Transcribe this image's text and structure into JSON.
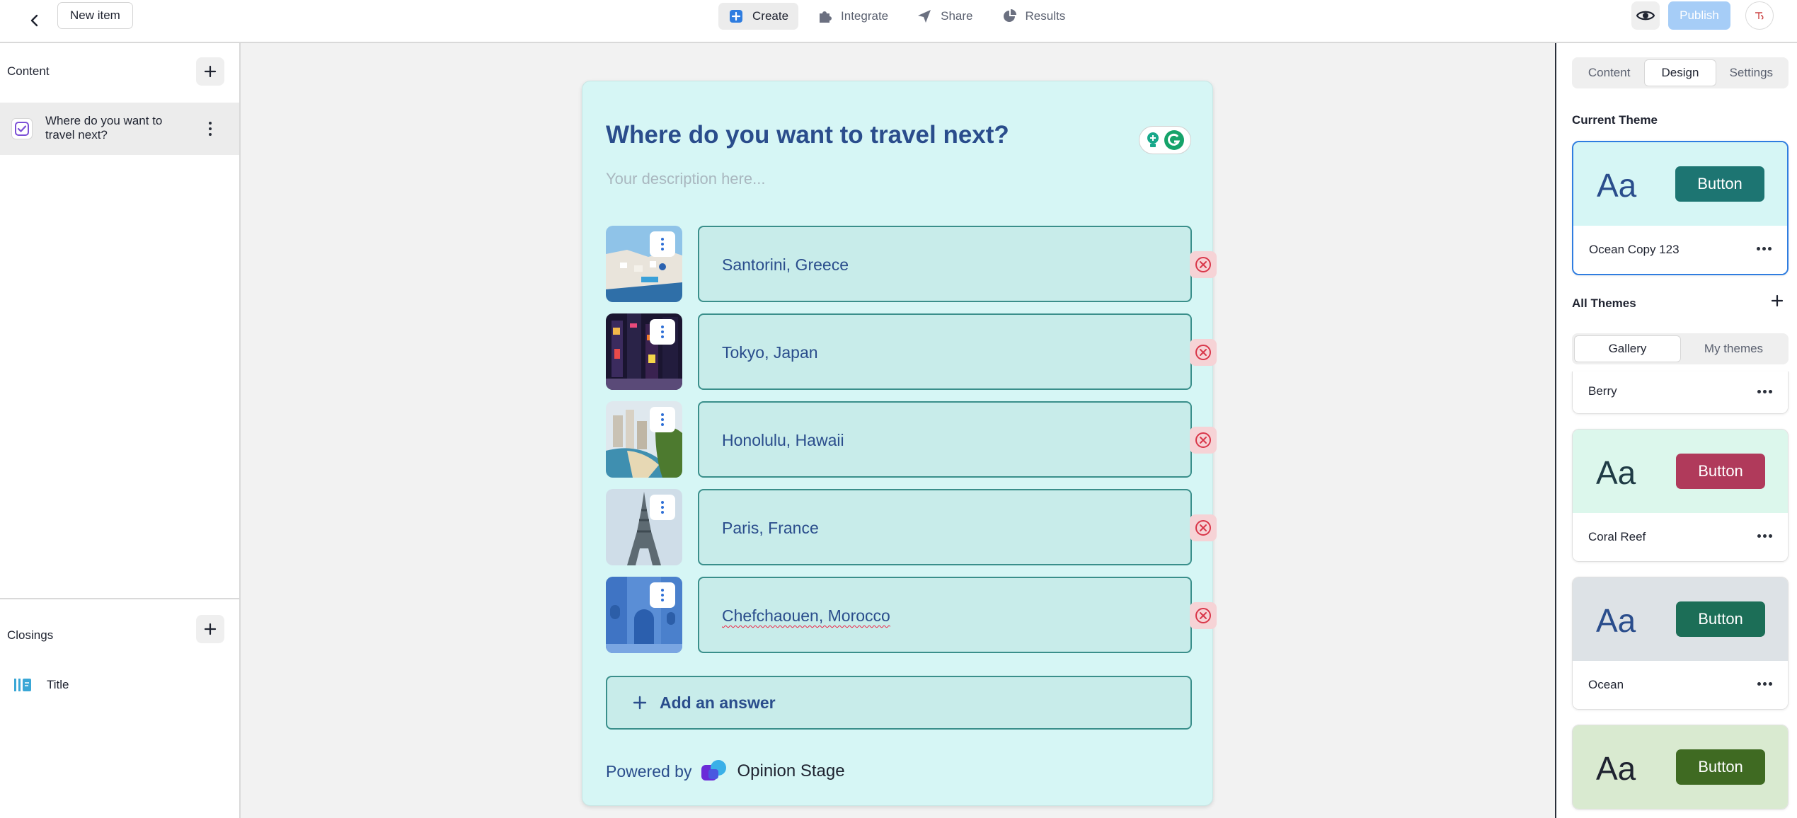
{
  "header": {
    "item_name": "New item",
    "nav": [
      {
        "label": "Create",
        "icon": "plus-square-icon",
        "active": true
      },
      {
        "label": "Integrate",
        "icon": "puzzle-icon",
        "active": false
      },
      {
        "label": "Share",
        "icon": "paper-plane-icon",
        "active": false
      },
      {
        "label": "Results",
        "icon": "pie-chart-icon",
        "active": false
      }
    ],
    "publish_label": "Publish",
    "accent_color": "#2f7de0"
  },
  "sidebar": {
    "content_heading": "Content",
    "content_items": [
      {
        "label": "Where do you want to travel next?",
        "icon": "checkbox-icon"
      }
    ],
    "closings_heading": "Closings",
    "closing_items": [
      {
        "label": "Title",
        "icon": "title-block-icon"
      }
    ]
  },
  "question": {
    "title": "Where do you want to travel next?",
    "description_placeholder": "Your description here...",
    "answers": [
      {
        "label": "Santorini, Greece",
        "image": "santorini-photo"
      },
      {
        "label": "Tokyo, Japan",
        "image": "tokyo-photo"
      },
      {
        "label": "Honolulu, Hawaii",
        "image": "honolulu-photo"
      },
      {
        "label": "Paris, France",
        "image": "eiffel-tower-photo"
      },
      {
        "label": "Chefchaouen, Morocco",
        "image": "chefchaouen-photo"
      }
    ],
    "add_answer_label": "Add an answer",
    "powered_by": "Powered by",
    "brand_name": "Opinion Stage",
    "card_color": "#d6f6f5",
    "text_color": "#2a4d8c"
  },
  "right_panel": {
    "tabs": [
      {
        "label": "Content",
        "active": false
      },
      {
        "label": "Design",
        "active": true
      },
      {
        "label": "Settings",
        "active": false
      }
    ],
    "current_theme_heading": "Current Theme",
    "current_theme": {
      "name": "Ocean Copy 123",
      "sample": "Aa",
      "button_label": "Button",
      "bg": "#d6f6f5",
      "button_color": "#1d7572",
      "aa_color": "#2a4d8c"
    },
    "all_themes_heading": "All Themes",
    "sub_tabs": [
      {
        "label": "Gallery",
        "active": true
      },
      {
        "label": "My themes",
        "active": false
      }
    ],
    "themes": [
      {
        "name": "Berry"
      },
      {
        "name": "Coral Reef",
        "sample": "Aa",
        "button_label": "Button",
        "bg": "#dcf7ec",
        "button_color": "#b03a5b",
        "aa_color": "#1f3b45"
      },
      {
        "name": "Ocean",
        "sample": "Aa",
        "button_label": "Button",
        "bg": "#dde2e6",
        "button_color": "#1c6e57",
        "aa_color": "#2a4d8c"
      },
      {
        "name": "",
        "sample": "Aa",
        "button_label": "Button",
        "bg": "#d9ead0",
        "button_color": "#3f6a22",
        "aa_color": "#1f2330"
      }
    ]
  }
}
